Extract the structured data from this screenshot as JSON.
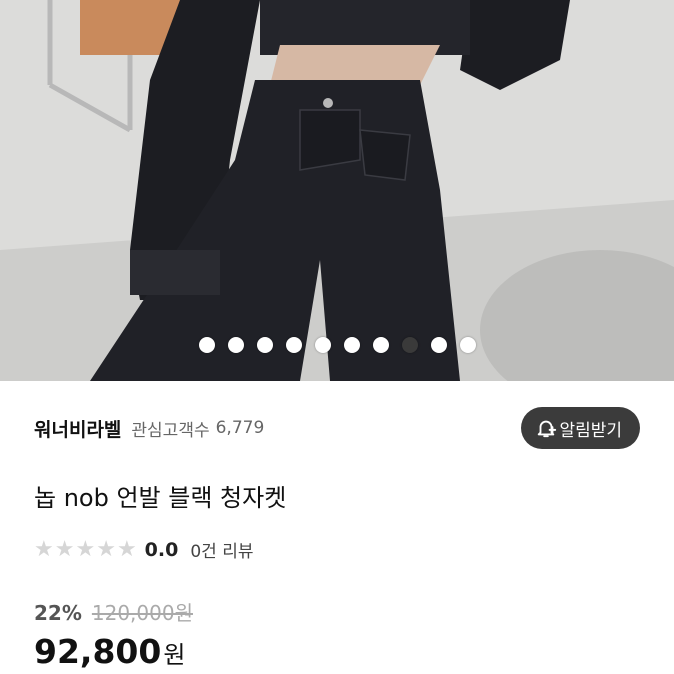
{
  "product": {
    "carousel": {
      "slide_count": 10,
      "active_index": 7
    },
    "seller": {
      "name": "워너비라벨",
      "follower_label": "관심고객수",
      "follower_count": "6,779",
      "alarm_label": "알림받기",
      "alarm_icon": "bell-plus-icon"
    },
    "title": "놉 nob 언발 블랙 청자켓",
    "rating": {
      "value": "0.0",
      "stars": 0,
      "max_stars": 5,
      "review_text": "0건 리뷰"
    },
    "pricing": {
      "discount": "22%",
      "original_price": "120,000원",
      "price": "92,800",
      "currency": "원"
    }
  }
}
